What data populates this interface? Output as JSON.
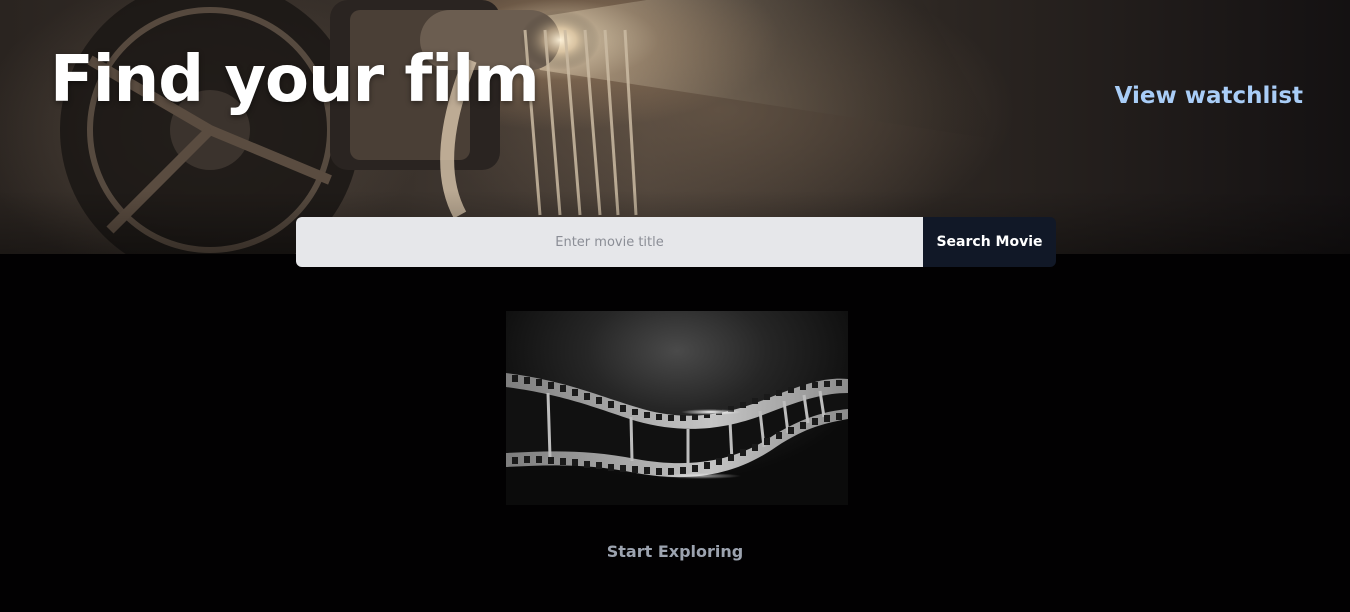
{
  "hero": {
    "title": "Find your film",
    "watchlist_link": "View watchlist"
  },
  "search": {
    "placeholder": "Enter movie title",
    "value": "",
    "button_label": "Search Movie"
  },
  "empty_state": {
    "illustration": "film-strip-icon",
    "label": "Start Exploring"
  },
  "colors": {
    "background": "#020102",
    "accent_link": "#a9cdf7",
    "button": "#111827",
    "input": "#e6e7ea",
    "muted_text": "#9ca3af"
  }
}
